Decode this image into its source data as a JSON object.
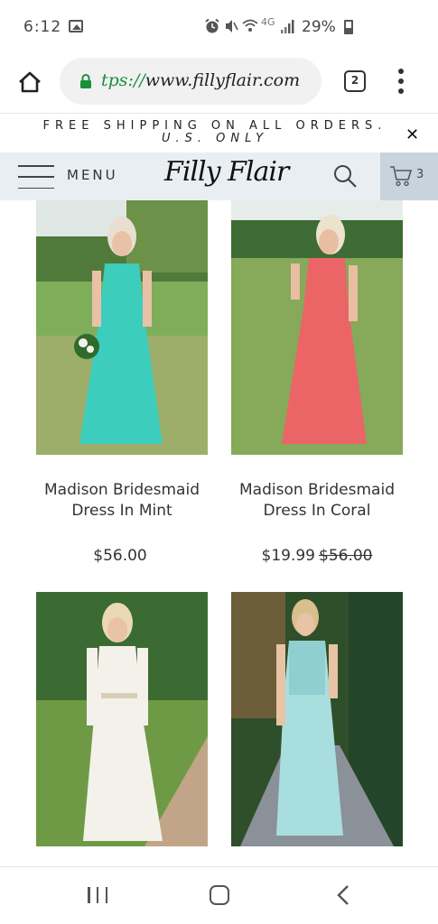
{
  "status_bar": {
    "time": "6:12",
    "network": "4G",
    "battery": "29%"
  },
  "browser": {
    "url_scheme": "tps://",
    "url_host": "www.fillyflair.com",
    "tab_count": "2"
  },
  "promo": {
    "line1": "FREE SHIPPING ON ALL ORDERS.",
    "line2": "U.S. ONLY"
  },
  "header": {
    "menu_label": "MENU",
    "logo": "Filly Flair",
    "cart_count": "3"
  },
  "products": [
    {
      "name": "Madison Bridesmaid Dress In Mint",
      "price": "$56.00",
      "old_price": ""
    },
    {
      "name": "Madison Bridesmaid Dress In Coral",
      "price": "$19.99",
      "old_price": "$56.00"
    },
    {
      "name": "",
      "price": "",
      "old_price": ""
    },
    {
      "name": "",
      "price": "",
      "old_price": ""
    }
  ],
  "colors": {
    "header_bg": "#e9eef2",
    "cart_bg": "#c7d4de",
    "secure_green": "#1a8f3c",
    "mint_dress": "#3ccdbd",
    "coral_dress": "#ec6566",
    "white_dress": "#f4f1ea",
    "aqua_dress": "#a9dede"
  }
}
